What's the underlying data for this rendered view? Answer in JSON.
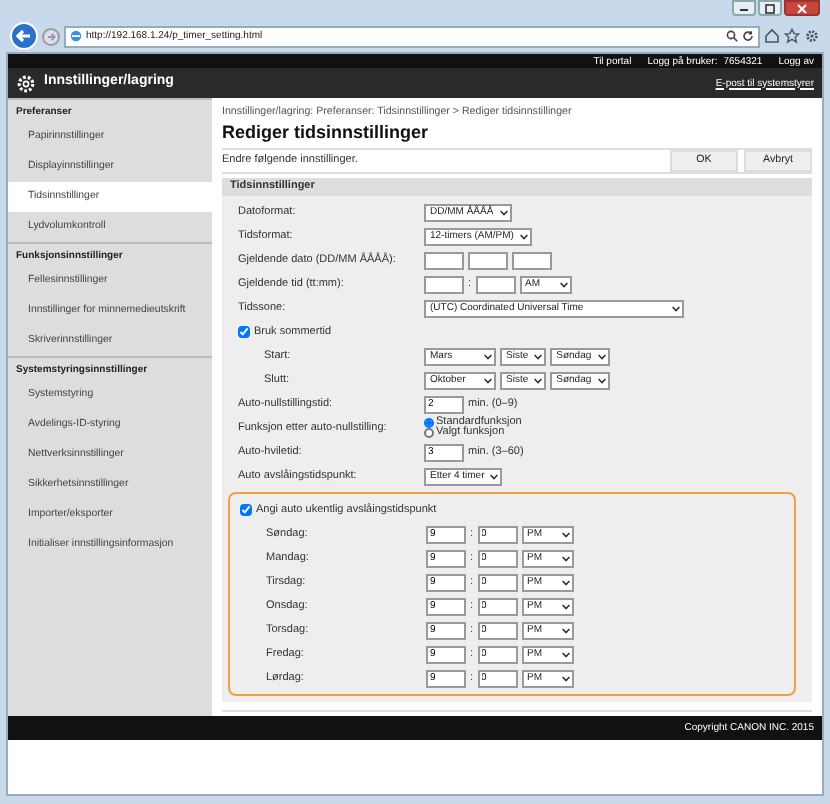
{
  "window": {
    "url": "http://192.168.1.24/p_timer_setting.html"
  },
  "top_bar": {
    "portal_link": "Til portal",
    "user_label": "Logg på bruker:",
    "user_id": "7654321",
    "logout_link": "Logg av"
  },
  "header": {
    "title": "Innstillinger/lagring",
    "mail_link": "E-post til systemstyrer"
  },
  "sidebar": [
    {
      "heading": "Preferanser",
      "items": [
        {
          "label": "Papirinnstillinger",
          "selected": false
        },
        {
          "label": "Displayinnstillinger",
          "selected": false
        },
        {
          "label": "Tidsinnstillinger",
          "selected": true
        },
        {
          "label": "Lydvolumkontroll",
          "selected": false
        }
      ]
    },
    {
      "heading": "Funksjonsinnstillinger",
      "items": [
        {
          "label": "Fellesinnstillinger",
          "selected": false
        },
        {
          "label": "Innstillinger for minnemedieutskrift",
          "selected": false
        },
        {
          "label": "Skriverinnstillinger",
          "selected": false
        }
      ]
    },
    {
      "heading": "Systemstyringsinnstillinger",
      "items": [
        {
          "label": "Systemstyring",
          "selected": false
        },
        {
          "label": "Avdelings-ID-styring",
          "selected": false
        },
        {
          "label": "Nettverksinnstillinger",
          "selected": false
        },
        {
          "label": "Sikkerhetsinnstillinger",
          "selected": false
        },
        {
          "label": "Importer/eksporter",
          "selected": false
        },
        {
          "label": "Initialiser innstillingsinformasjon",
          "selected": false
        }
      ]
    }
  ],
  "breadcrumb": "Innstillinger/lagring: Preferanser: Tidsinnstillinger > Rediger tidsinnstillinger",
  "page_title": "Rediger tidsinnstillinger",
  "instruction": "Endre følgende innstillinger.",
  "buttons": [
    "OK",
    "Avbryt"
  ],
  "section": {
    "title": "Tidsinnstillinger",
    "rows": [
      {
        "kind": "select",
        "label": "Datoformat:",
        "values": [
          "DD/MM ÅÅÅÅ"
        ]
      },
      {
        "kind": "select",
        "label": "Tidsformat:",
        "values": [
          "12-timers (AM/PM)"
        ]
      },
      {
        "kind": "date",
        "label": "Gjeldende dato (DD/MM ÅÅÅÅ):"
      },
      {
        "kind": "time",
        "label": "Gjeldende tid (tt:mm):",
        "separator": ":",
        "values": [
          "AM"
        ]
      },
      {
        "kind": "wide_select",
        "label": "Tidssone:",
        "values": [
          "(UTC) Coordinated Universal Time"
        ]
      },
      {
        "kind": "checkbox",
        "label": "Bruk sommertid",
        "checked": true
      },
      {
        "kind": "sub_selects",
        "label": "Start:",
        "values": [
          "Mars",
          "Siste",
          "Søndag"
        ]
      },
      {
        "kind": "sub_selects",
        "label": "Slutt:",
        "values": [
          "Oktober",
          "Siste",
          "Søndag"
        ]
      },
      {
        "kind": "number",
        "label": "Auto-nullstillingstid:",
        "value": "2",
        "hint": "min. (0–9)"
      },
      {
        "kind": "radio",
        "label": "Funksjon etter auto-nullstilling:",
        "options": [
          {
            "label": "Standardfunksjon",
            "selected": true
          },
          {
            "label": "Valgt funksjon",
            "selected": false
          }
        ]
      },
      {
        "kind": "number",
        "label": "Auto-hviletid:",
        "value": "3",
        "hint": "min. (3–60)"
      },
      {
        "kind": "select",
        "label": "Auto avslåingstidspunkt:",
        "values": [
          "Etter 4 timer"
        ]
      }
    ],
    "weekly": {
      "label": "Angi auto ukentlig avslåingstidspunkt",
      "checked": true,
      "highlighted": true,
      "separator": ":",
      "days": [
        {
          "label": "Søndag:",
          "hour": "9",
          "minute": "0",
          "period": "PM"
        },
        {
          "label": "Mandag:",
          "hour": "9",
          "minute": "0",
          "period": "PM"
        },
        {
          "label": "Tirsdag:",
          "hour": "9",
          "minute": "0",
          "period": "PM"
        },
        {
          "label": "Onsdag:",
          "hour": "9",
          "minute": "0",
          "period": "PM"
        },
        {
          "label": "Torsdag:",
          "hour": "9",
          "minute": "0",
          "period": "PM"
        },
        {
          "label": "Fredag:",
          "hour": "9",
          "minute": "0",
          "period": "PM"
        },
        {
          "label": "Lørdag:",
          "hour": "9",
          "minute": "0",
          "period": "PM"
        }
      ]
    }
  },
  "footer": "Copyright CANON INC. 2015"
}
